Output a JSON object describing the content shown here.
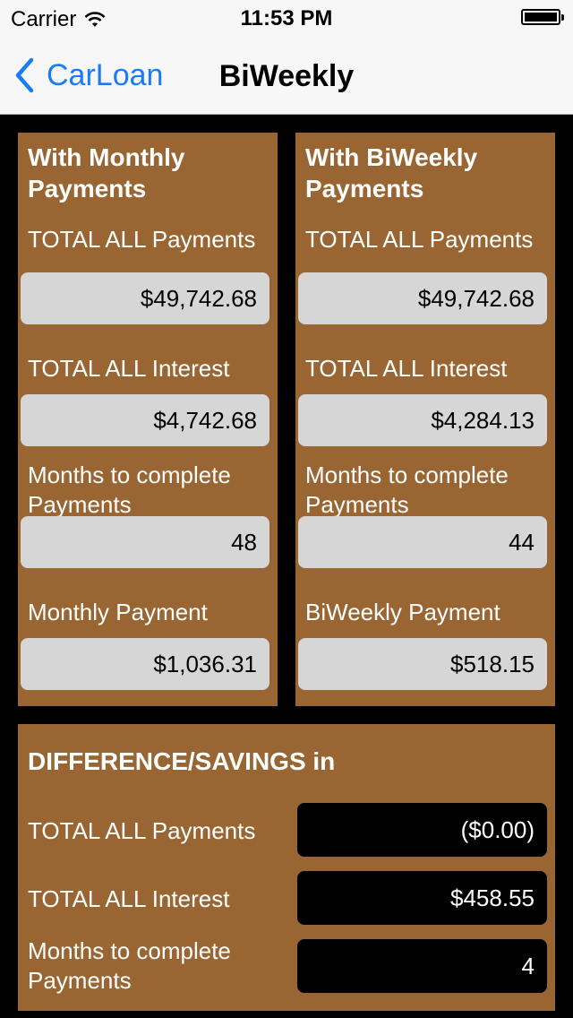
{
  "status_bar": {
    "carrier": "Carrier",
    "time": "11:53 PM"
  },
  "nav": {
    "back_label": "CarLoan",
    "title": "BiWeekly"
  },
  "monthly": {
    "title": "With Monthly Payments",
    "total_payments_label": "TOTAL ALL Payments",
    "total_payments_value": "$49,742.68",
    "total_interest_label": "TOTAL ALL Interest",
    "total_interest_value": "$4,742.68",
    "months_label": "Months to complete Payments",
    "months_value": "48",
    "payment_label": "Monthly Payment",
    "payment_value": "$1,036.31"
  },
  "biweekly": {
    "title": "With BiWeekly Payments",
    "total_payments_label": "TOTAL ALL Payments",
    "total_payments_value": "$49,742.68",
    "total_interest_label": "TOTAL ALL Interest",
    "total_interest_value": "$4,284.13",
    "months_label": "Months to complete Payments",
    "months_value": "44",
    "payment_label": "BiWeekly Payment",
    "payment_value": "$518.15"
  },
  "difference": {
    "title": "DIFFERENCE/SAVINGS in",
    "total_payments_label": "TOTAL ALL Payments",
    "total_payments_value": "($0.00)",
    "total_interest_label": "TOTAL ALL Interest",
    "total_interest_value": "$458.55",
    "months_label": "Months to complete Payments",
    "months_value": "4"
  },
  "colors": {
    "panel": "#996633",
    "accent": "#1a7cf5",
    "field": "#d6d6d6"
  }
}
